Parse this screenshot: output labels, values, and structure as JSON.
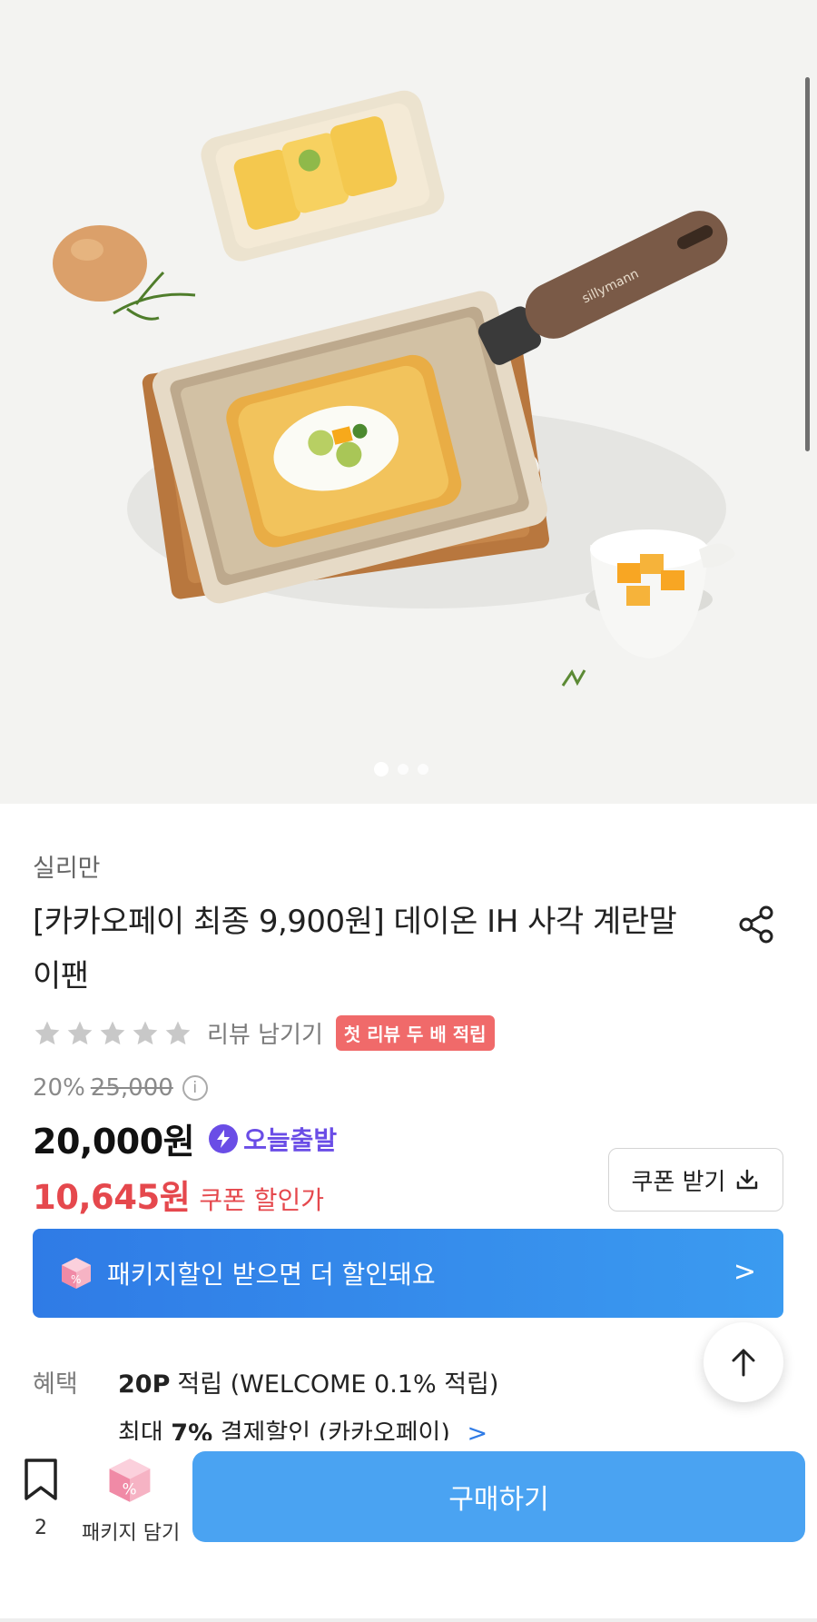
{
  "hero": {
    "handle_brand": "sillymann",
    "carousel": {
      "total": 3,
      "active": 1
    }
  },
  "product": {
    "brand": "실리만",
    "title": "[카카오페이 최종 9,900원] 데이온 IH 사각 계란말이팬",
    "rating": {
      "stars": 0,
      "review_link": "리뷰 남기기",
      "badge": "첫 리뷰 두 배 적립"
    },
    "discount_rate": "20%",
    "original_price": "25,000",
    "price": "20,000원",
    "shipping_badge": "오늘출발",
    "coupon_price": "10,645원",
    "coupon_label": "쿠폰 할인가",
    "coupon_button": "쿠폰 받기"
  },
  "package_banner": {
    "text": "패키지할인 받으면 더 할인돼요",
    "chevron": ">"
  },
  "benefits": {
    "label": "혜택",
    "points_amount": "20P",
    "points_text": "적립 (WELCOME 0.1% 적립)",
    "payment_prefix": "최대",
    "payment_rate": "7%",
    "payment_text": "결제할인 (카카오페이)",
    "payment_chevron": ">"
  },
  "bottom_bar": {
    "wish_count": "2",
    "package_label": "패키지 담기",
    "buy_label": "구매하기"
  },
  "colors": {
    "accent_blue": "#2f7be6",
    "sale_red": "#e5484d",
    "badge_purple": "#6a4de6",
    "badge_pink": "#f06a6a",
    "buy_blue": "#4aa3f2"
  },
  "icons": [
    "share-icon",
    "star-icon",
    "info-icon",
    "bolt-icon",
    "download-icon",
    "package-icon",
    "chevron-right-icon",
    "arrow-up-icon",
    "bookmark-icon"
  ]
}
